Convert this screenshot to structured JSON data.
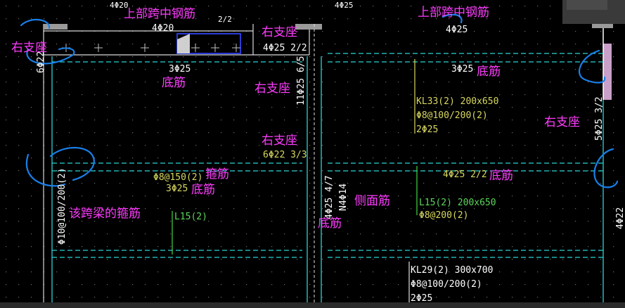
{
  "labels": {
    "top_mid_1": "上部跨中钢筋",
    "top_mid_2": "上部跨中钢筋",
    "right_support_1": "右支座",
    "right_support_2": "右支座",
    "right_support_3": "右支座",
    "right_support_4": "右支座",
    "right_support_5": "右支座",
    "bottom_bar_1": "底筋",
    "bottom_bar_2": "底筋",
    "bottom_bar_3": "底筋",
    "bottom_bar_4": "底筋",
    "bottom_bar_5": "底筋",
    "stirrup": "箍筋",
    "side_bar": "侧面筋",
    "span_stirrup": "该跨梁的箍筋"
  },
  "cad": {
    "top_20": "4Φ20",
    "top_12": "4Φ20",
    "top_partial": "2/2",
    "top_425_mid": "4Φ25",
    "top_425_right": "4Φ25",
    "support_425_22": "4Φ25 2/2",
    "left_vert_622": "6Φ22",
    "bot_325_left": "3Φ25",
    "bot_325_right": "3Φ25",
    "col_vert_1125": "11Φ25 6/5",
    "kl33": "KL33(2) 200x650",
    "kl33_stirrup": "Φ8@100/200(2)",
    "kl33_top": "2Φ25",
    "right_vert_525": "5Φ25 3/2",
    "support_622": "6Φ22 3/3",
    "stir_150": "Φ8@150(2)",
    "bot_325_mid": "3Φ25",
    "l15_left": "L15(2)",
    "left_vert_10": "Φ10@100/200(2)",
    "vert_425_47": "4Φ25 4/7",
    "vert_n4": "N4Φ14",
    "bot_425_22": "4Φ25 2/2",
    "l15_right": "L15(2) 200x650",
    "l15_right_stirrup": "Φ8@200(2)",
    "kl29": "KL29(2) 300x700",
    "kl29_stirrup": "Φ8@100/200(2)",
    "kl29_top": "2Φ25",
    "top_425_small": "4Φ25",
    "right_edge_vert": "4Φ22"
  },
  "colors": {
    "cyan": "#2ad4d4",
    "magenta": "#ff3cff",
    "yellow": "#d8d860",
    "green": "#3cc83c",
    "blue_mark": "#1a7fe8",
    "grid": "#7a7a7a"
  }
}
